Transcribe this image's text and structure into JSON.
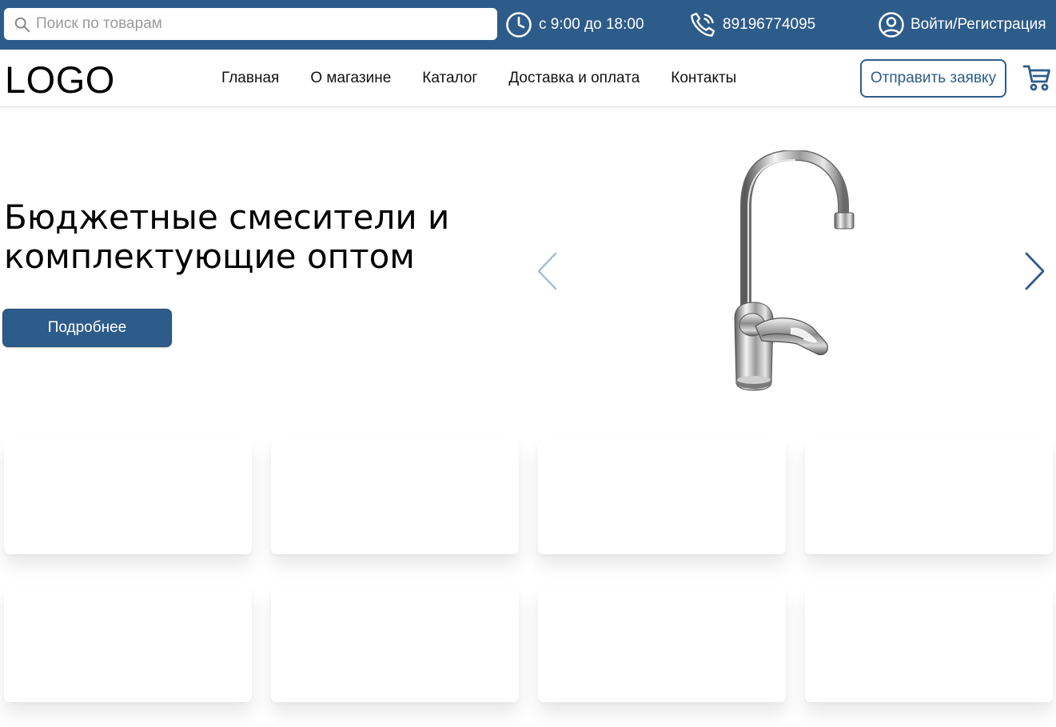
{
  "topbar": {
    "search": {
      "placeholder": "Поиск по товарам",
      "value": ""
    },
    "hours": "с 9:00 до 18:00",
    "phone": "89196774095",
    "login": "Войти/Регистрация"
  },
  "header": {
    "logo": "LOGO",
    "nav": [
      "Главная",
      "О магазине",
      "Каталог",
      "Доставка и оплата",
      "Контакты"
    ],
    "request_button": "Отправить заявку"
  },
  "hero": {
    "title": "Бюджетные смесители и комплектующие оптом",
    "more_button": "Подробнее"
  },
  "colors": {
    "brand": "#2e5c8a",
    "arrow_prev": "#a9c0d6",
    "arrow_next": "#2e5c8a",
    "background": "#ffffff"
  },
  "icons": {
    "search": "search-icon",
    "hours": "clock-icon",
    "phone": "phone-icon",
    "login": "user-circle-icon",
    "cart": "cart-icon",
    "prev": "chevron-left-icon",
    "next": "chevron-right-icon"
  },
  "cards_count": 8
}
